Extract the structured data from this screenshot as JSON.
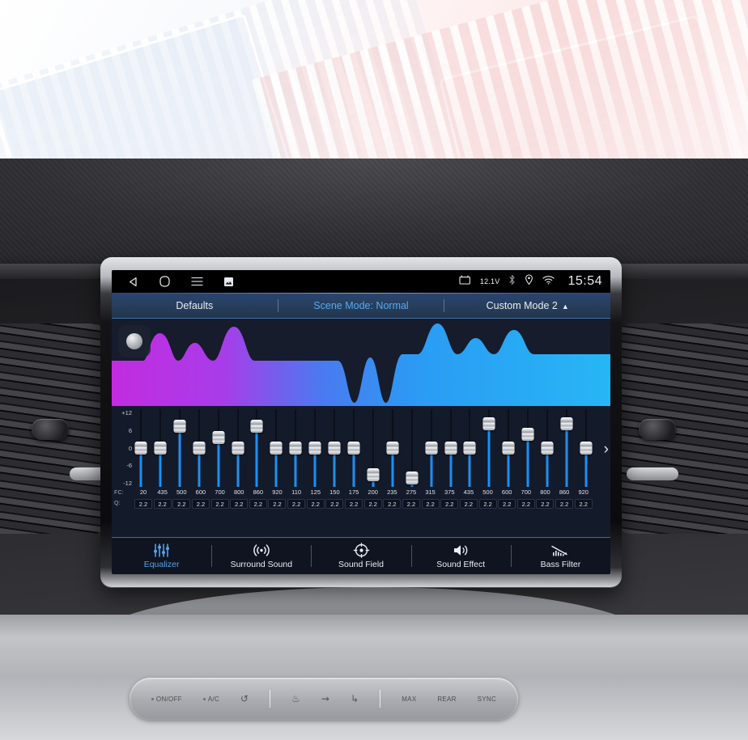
{
  "statusbar": {
    "nav": [
      {
        "name": "back-icon",
        "label": "back"
      },
      {
        "name": "home-icon",
        "label": "home"
      },
      {
        "name": "menu-icon",
        "label": "menu"
      },
      {
        "name": "screenshot-icon",
        "label": "screenshot"
      }
    ],
    "voltage": "12.1V",
    "battery_icon": "battery-icon",
    "bluetooth_icon": "bluetooth-icon",
    "location_icon": "location-pin-icon",
    "wifi_icon": "wifi-icon",
    "clock": "15:54"
  },
  "modebar": {
    "defaults": "Defaults",
    "scene_mode": "Scene Mode: Normal",
    "custom_mode": "Custom Mode 2",
    "custom_caret": "▲",
    "active_color": "#58a9f0"
  },
  "waveform": {
    "power_button_icon": "power-knob-icon",
    "gradient_start": "#c22ce0",
    "gradient_mid": "#3a6ef0",
    "gradient_end": "#27b6f5"
  },
  "equalizer": {
    "scale_labels": [
      "+12",
      "6",
      "0",
      "-6",
      "-12"
    ],
    "scale_max": 12,
    "scale_min": -12,
    "fc_label": "FC:",
    "q_label": "Q:",
    "pager_next_icon": "chevron-right-icon",
    "bands": [
      {
        "fc": "20",
        "q": "2.2",
        "gain": 0
      },
      {
        "fc": "435",
        "q": "2.2",
        "gain": 0
      },
      {
        "fc": "500",
        "q": "2.2",
        "gain": 8
      },
      {
        "fc": "600",
        "q": "2.2",
        "gain": 0
      },
      {
        "fc": "700",
        "q": "2.2",
        "gain": 4
      },
      {
        "fc": "800",
        "q": "2.2",
        "gain": 0
      },
      {
        "fc": "860",
        "q": "2.2",
        "gain": 8
      },
      {
        "fc": "920",
        "q": "2.2",
        "gain": 0
      },
      {
        "fc": "110",
        "q": "2.2",
        "gain": 0
      },
      {
        "fc": "125",
        "q": "2.2",
        "gain": 0
      },
      {
        "fc": "150",
        "q": "2.2",
        "gain": 0
      },
      {
        "fc": "175",
        "q": "2.2",
        "gain": 0
      },
      {
        "fc": "200",
        "q": "2.2",
        "gain": -10
      },
      {
        "fc": "235",
        "q": "2.2",
        "gain": 0
      },
      {
        "fc": "275",
        "q": "2.2",
        "gain": -11
      },
      {
        "fc": "315",
        "q": "2.2",
        "gain": 0
      },
      {
        "fc": "375",
        "q": "2.2",
        "gain": 0
      },
      {
        "fc": "435",
        "q": "2.2",
        "gain": 0
      },
      {
        "fc": "500",
        "q": "2.2",
        "gain": 9
      },
      {
        "fc": "600",
        "q": "2.2",
        "gain": 0
      },
      {
        "fc": "700",
        "q": "2.2",
        "gain": 5
      },
      {
        "fc": "800",
        "q": "2.2",
        "gain": 0
      },
      {
        "fc": "860",
        "q": "2.2",
        "gain": 9
      },
      {
        "fc": "920",
        "q": "2.2",
        "gain": 0
      }
    ]
  },
  "tabs": [
    {
      "label": "Equalizer",
      "icon": "equalizer-icon",
      "active": true
    },
    {
      "label": "Surround Sound",
      "icon": "surround-sound-icon",
      "active": false
    },
    {
      "label": "Sound Field",
      "icon": "sound-field-icon",
      "active": false
    },
    {
      "label": "Sound Effect",
      "icon": "speaker-icon",
      "active": false
    },
    {
      "label": "Bass Filter",
      "icon": "bass-filter-icon",
      "active": false
    }
  ],
  "climate": {
    "buttons": [
      {
        "label": "ON/OFF",
        "icon": "power-dot-icon"
      },
      {
        "label": "A/C",
        "icon": "ac-dot-icon"
      },
      {
        "label": "",
        "icon": "recirculate-icon",
        "glyph": "↺"
      },
      {
        "label": "",
        "icon": "windshield-defrost-icon",
        "glyph": "♨"
      },
      {
        "label": "",
        "icon": "face-vent-icon",
        "glyph": "⇝"
      },
      {
        "label": "",
        "icon": "floor-vent-icon",
        "glyph": "↳"
      },
      {
        "label": "MAX",
        "icon": "max-defrost-icon"
      },
      {
        "label": "REAR",
        "icon": "rear-defrost-icon"
      },
      {
        "label": "SYNC",
        "icon": "sync-icon"
      }
    ]
  }
}
